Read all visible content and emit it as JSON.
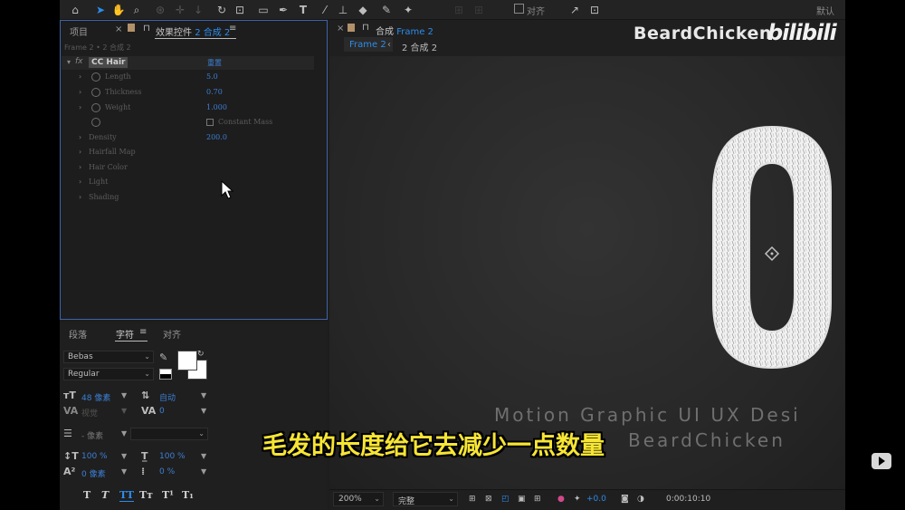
{
  "toolbar": {
    "align_label": "对齐",
    "default_label": "默认"
  },
  "effect_controls": {
    "tab_project": "项目",
    "tab_effects_prefix": "效果控件",
    "tab_effects_comp": "2 合成 2",
    "breadcrumb": "Frame 2 • 2 合成 2",
    "effect_name": "CC Hair",
    "reset_label": "重置",
    "properties": [
      {
        "name": "Length",
        "value": "5.0"
      },
      {
        "name": "Thickness",
        "value": "0.70"
      },
      {
        "name": "Weight",
        "value": "1.000"
      },
      {
        "name": "",
        "value": ""
      },
      {
        "name": "Density",
        "value": "200.0"
      },
      {
        "name": "Hairfall Map",
        "value": ""
      },
      {
        "name": "Hair Color",
        "value": ""
      },
      {
        "name": "Light",
        "value": ""
      },
      {
        "name": "Shading",
        "value": ""
      }
    ],
    "constant_mass_label": "Constant Mass"
  },
  "character_panel": {
    "tab_paragraph": "段落",
    "tab_character": "字符",
    "tab_align": "对齐",
    "font_family": "Bebas",
    "font_style": "Regular",
    "font_size": "48 像素",
    "leading": "自动",
    "kerning": "视觉",
    "tracking": "0",
    "stroke_width": "- 像素",
    "vertical_scale": "100 %",
    "horizontal_scale": "100 %",
    "baseline_shift": "0 像素",
    "tsume": "0 %",
    "format_buttons": [
      "T",
      "T",
      "TT",
      "Tт",
      "T¹",
      "T₁"
    ]
  },
  "composition": {
    "tab_prefix": "合成",
    "tab_name": "Frame 2",
    "breadcrumb_current": "Frame 2",
    "breadcrumb_parent": "2 合成 2",
    "brand_name": "BeardChicken",
    "brand_logo": "bilibili",
    "motion_text": "Motion Graphic UI UX Desi",
    "author_text": "BeardChicken",
    "subtitle": "毛发的长度给它去减少一点数量",
    "zoom": "200%",
    "resolution": "完整",
    "exposure": "+0.0",
    "timecode": "0:00:10:10"
  },
  "colors": {
    "accent": "#2d8ceb",
    "value_blue": "#3c7fd4",
    "subtitle_fill": "#f7e534",
    "panel_bg": "#1d1d1d"
  }
}
